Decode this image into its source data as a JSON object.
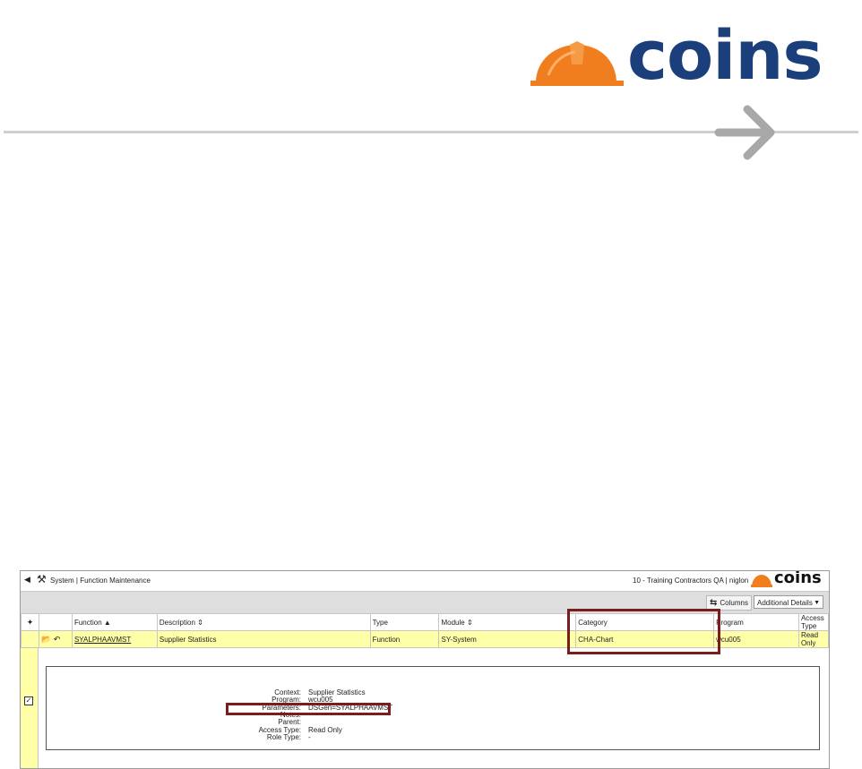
{
  "slide": {
    "brand": "coins",
    "brand_color": "#1b3f7a",
    "hat_color": "#f07e1e",
    "arrow_color": "#a8a8a8"
  },
  "app": {
    "back_icon": "caret-left-icon",
    "tools_icon": "tools-icon",
    "title": "System | Function Maintenance",
    "environment": "10 - Training Contractors QA | niglon",
    "mini_brand": "coins",
    "columns_label": "Columns",
    "details_select": "Additional Details"
  },
  "grid": {
    "headers": {
      "function": "Function",
      "description": "Description",
      "type": "Type",
      "module": "Module",
      "category": "Category",
      "program": "Program",
      "access": "Access Type"
    },
    "row": {
      "function": "SYALPHAAVMST",
      "description": "Supplier Statistics",
      "type": "Function",
      "module": "SY-System",
      "category": "CHA-Chart",
      "program": "wcu005",
      "access": "Read Only"
    }
  },
  "details": [
    {
      "key": "Context:",
      "value": "Supplier Statistics"
    },
    {
      "key": "Program:",
      "value": "wcu005"
    },
    {
      "key": "Parameters:",
      "value": "DSGen=SYALPHAAVMST"
    },
    {
      "key": "Notes:",
      "value": ""
    },
    {
      "key": "Parent:",
      "value": ""
    },
    {
      "key": "Access Type:",
      "value": "Read Only"
    },
    {
      "key": "Role Type:",
      "value": "-"
    }
  ],
  "highlight_color": "#7a1d1d",
  "row_color": "#ffffa8"
}
